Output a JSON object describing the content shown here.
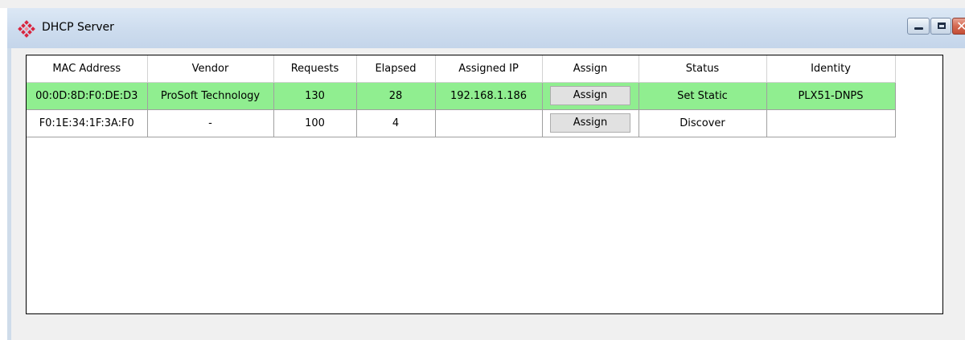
{
  "window": {
    "title": "DHCP Server",
    "icon": "prosoft-diamond-icon",
    "controls": [
      "minimize-icon",
      "maximize-icon",
      "close-icon"
    ],
    "close_glyph": "✕"
  },
  "table": {
    "headers": [
      "MAC Address",
      "Vendor",
      "Requests",
      "Elapsed",
      "Assigned IP",
      "Assign",
      "Status",
      "Identity"
    ],
    "rows": [
      {
        "mac": "00:0D:8D:F0:DE:D3",
        "vendor": "ProSoft Technology",
        "requests": "130",
        "elapsed": "28",
        "assigned_ip": "192.168.1.186",
        "assign_label": "Assign",
        "status": "Set Static",
        "identity": "PLX51-DNPS",
        "highlight_color": "#90ee90"
      },
      {
        "mac": "F0:1E:34:1F:3A:F0",
        "vendor": "-",
        "requests": "100",
        "elapsed": "4",
        "assigned_ip": "",
        "assign_label": "Assign",
        "status": "Discover",
        "identity": "",
        "highlight_color": "#ffffff"
      }
    ]
  },
  "colors": {
    "active_row": "#90ee90",
    "icon_red": "#d9253f"
  }
}
